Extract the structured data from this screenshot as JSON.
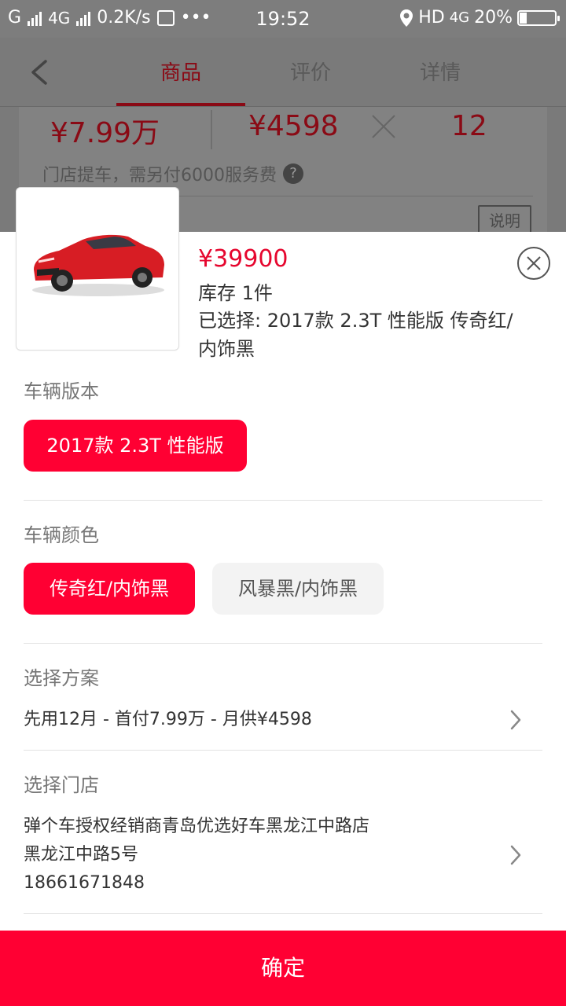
{
  "status_bar": {
    "carrier_left": "G",
    "network": "4G",
    "speed": "0.2K/s",
    "more": "•••",
    "time": "19:52",
    "hd": "HD",
    "network_right": "4G",
    "battery_percent": "20%",
    "battery_level": 0.2
  },
  "header": {
    "tabs": [
      {
        "label": "商品",
        "active": true
      },
      {
        "label": "评价",
        "active": false
      },
      {
        "label": "详情",
        "active": false
      }
    ]
  },
  "underlay": {
    "price_total": "¥7.99万",
    "monthly": "¥4598",
    "months": "12",
    "note": "门店提车，需另付6000服务费",
    "help": "?",
    "explain_button": "说明"
  },
  "sheet": {
    "price": "¥39900",
    "stock": "库存 1件",
    "selected": "已选择: 2017款 2.3T 性能版  传奇红/内饰黑",
    "version_label": "车辆版本",
    "version_option": "2017款 2.3T 性能版",
    "color_label": "车辆颜色",
    "color_options": [
      "传奇红/内饰黑",
      "风暴黑/内饰黑"
    ],
    "plan_label": "选择方案",
    "plan_value": "先用12月 - 首付7.99万 - 月供¥4598",
    "store_label": "选择门店",
    "store_name": "弹个车授权经销商青岛优选好车黑龙江中路店",
    "store_address": "黑龙江中路5号",
    "store_phone": "18661671848",
    "confirm_label": "确定"
  },
  "colors": {
    "accent": "#ff0033",
    "price": "#e6062e",
    "dim_accent": "#8a0a15"
  },
  "icons": [
    "back-arrow-icon",
    "close-icon",
    "chevron-right-icon",
    "help-icon",
    "location-icon",
    "cross-icon"
  ]
}
